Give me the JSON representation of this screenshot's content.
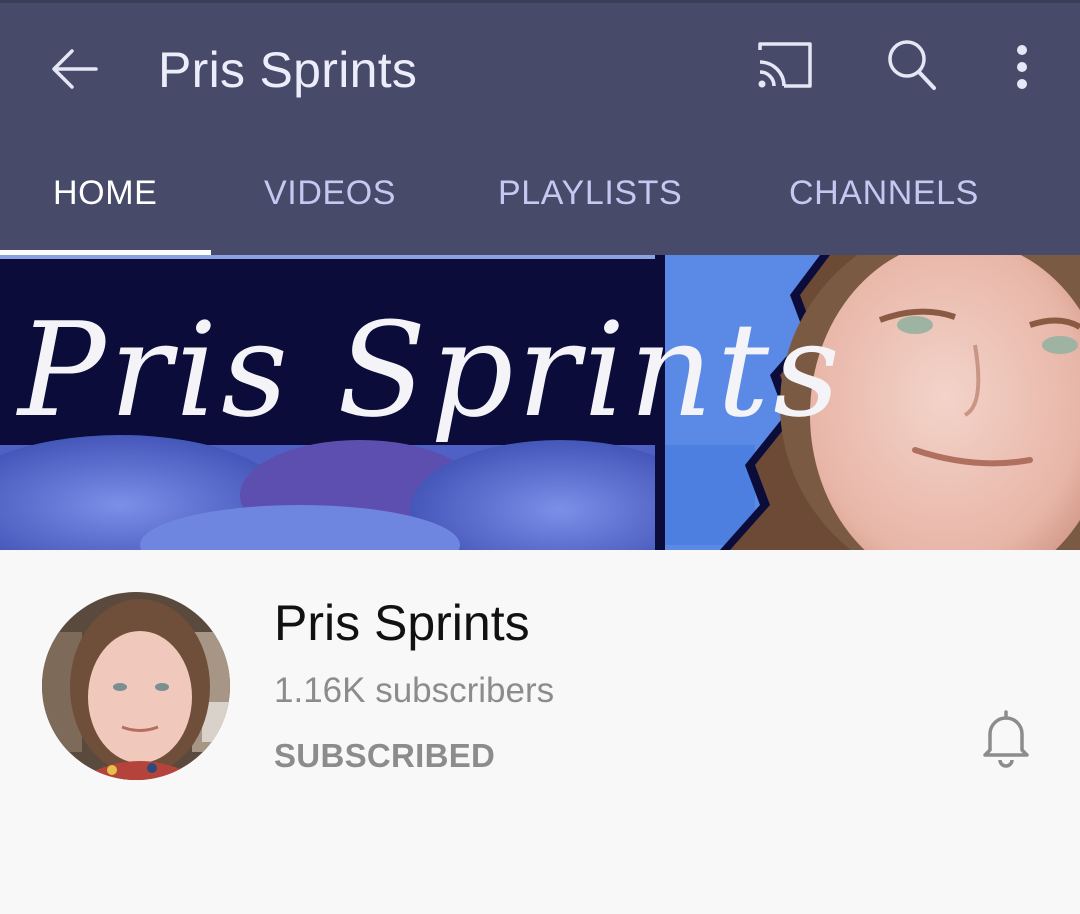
{
  "header": {
    "title": "Pris Sprints",
    "icons": [
      "back-arrow-icon",
      "cast-icon",
      "search-icon",
      "more-vert-icon"
    ]
  },
  "tabs": [
    {
      "label": "HOME",
      "active": true
    },
    {
      "label": "VIDEOS",
      "active": false
    },
    {
      "label": "PLAYLISTS",
      "active": false
    },
    {
      "label": "CHANNELS",
      "active": false
    }
  ],
  "banner": {
    "script_text": "Pris Sprints"
  },
  "channel": {
    "name": "Pris Sprints",
    "subscribers": "1.16K subscribers",
    "subscribe_state": "SUBSCRIBED",
    "notification_icon": "bell-icon"
  },
  "colors": {
    "appbar": "#474b69",
    "tab_text": "#c6c8f2",
    "tab_active": "#ffffff",
    "banner_dark": "#0b0c3a",
    "banner_blue": "#5a8ae6",
    "secondary_text": "#8c8c8c"
  }
}
